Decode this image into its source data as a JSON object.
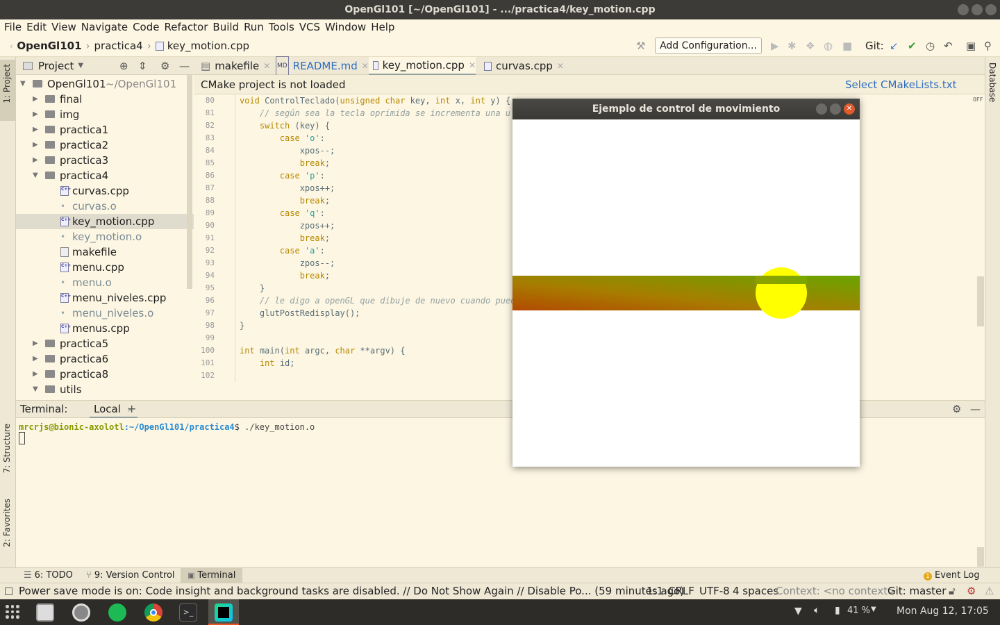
{
  "window": {
    "title": "OpenGl101 [~/OpenGl101] - .../practica4/key_motion.cpp"
  },
  "menu": [
    "File",
    "Edit",
    "View",
    "Navigate",
    "Code",
    "Refactor",
    "Build",
    "Run",
    "Tools",
    "VCS",
    "Window",
    "Help"
  ],
  "breadcrumb": {
    "project": "OpenGl101",
    "folder": "practica4",
    "file": "key_motion.cpp"
  },
  "toolbar": {
    "add_config": "Add Configuration...",
    "git_label": "Git:"
  },
  "project_panel": {
    "title": "Project",
    "tree": [
      {
        "label": "OpenGl101",
        "extra": "~/OpenGl101"
      },
      {
        "label": "final"
      },
      {
        "label": "img"
      },
      {
        "label": "practica1"
      },
      {
        "label": "practica2"
      },
      {
        "label": "practica3"
      },
      {
        "label": "practica4"
      },
      {
        "label": "curvas.cpp"
      },
      {
        "label": "curvas.o"
      },
      {
        "label": "key_motion.cpp"
      },
      {
        "label": "key_motion.o"
      },
      {
        "label": "makefile"
      },
      {
        "label": "menu.cpp"
      },
      {
        "label": "menu.o"
      },
      {
        "label": "menu_niveles.cpp"
      },
      {
        "label": "menu_niveles.o"
      },
      {
        "label": "menus.cpp"
      },
      {
        "label": "practica5"
      },
      {
        "label": "practica6"
      },
      {
        "label": "practica8"
      },
      {
        "label": "utils"
      }
    ]
  },
  "tabs": [
    "makefile",
    "README.md",
    "key_motion.cpp",
    "curvas.cpp"
  ],
  "cmake_notice": {
    "message": "CMake project is not loaded",
    "action": "Select CMakeLists.txt file..."
  },
  "code": {
    "line_numbers": [
      "80",
      "81",
      "82",
      "83",
      "84",
      "85",
      "86",
      "87",
      "88",
      "89",
      "90",
      "91",
      "92",
      "93",
      "94",
      "95",
      "96",
      "97",
      "98",
      "99",
      "100",
      "101",
      "102"
    ],
    "lines": [
      "void ControlTeclado(unsigned char key, int x, int y) {",
      "    // según sea la tecla oprimida se incrementa una u o",
      "    switch (key) {",
      "        case 'o':",
      "            xpos--;",
      "            break;",
      "        case 'p':",
      "            xpos++;",
      "            break;",
      "        case 'q':",
      "            zpos++;",
      "            break;",
      "        case 'a':",
      "            zpos--;",
      "            break;",
      "    }",
      "    // le digo a openGL que dibuje de nuevo cuando pueda",
      "    glutPostRedisplay();",
      "}",
      "",
      "int main(int argc, char **argv) {",
      "    int id;",
      ""
    ]
  },
  "gl_window": {
    "title": "Ejemplo de control de movimiento"
  },
  "terminal": {
    "header": "Terminal:",
    "tab": "Local",
    "user": "mrcrjs@bionic-axolotl",
    "path": ":~/OpenGl101/practica4",
    "command": "$ ./key_motion.o"
  },
  "bottom_tools": [
    "6: TODO",
    "9: Version Control",
    "Terminal"
  ],
  "event_log": "Event Log",
  "status": {
    "message": "Power save mode is on: Code insight and background tasks are disabled. // Do Not Show Again // Disable Po... (59 minutes ago)",
    "position": "1:1",
    "line_sep": "CRLF",
    "encoding": "UTF-8",
    "indent": "4 spaces",
    "context": "Context: <no context>",
    "git": "Git: master"
  },
  "side_labels": {
    "project": "1: Project",
    "structure": "7: Structure",
    "favorites": "2: Favorites",
    "database": "Database"
  },
  "editor_off_label": "OFF",
  "taskbar": {
    "battery": "41 %",
    "clock": "Mon Aug 12, 17:05"
  }
}
